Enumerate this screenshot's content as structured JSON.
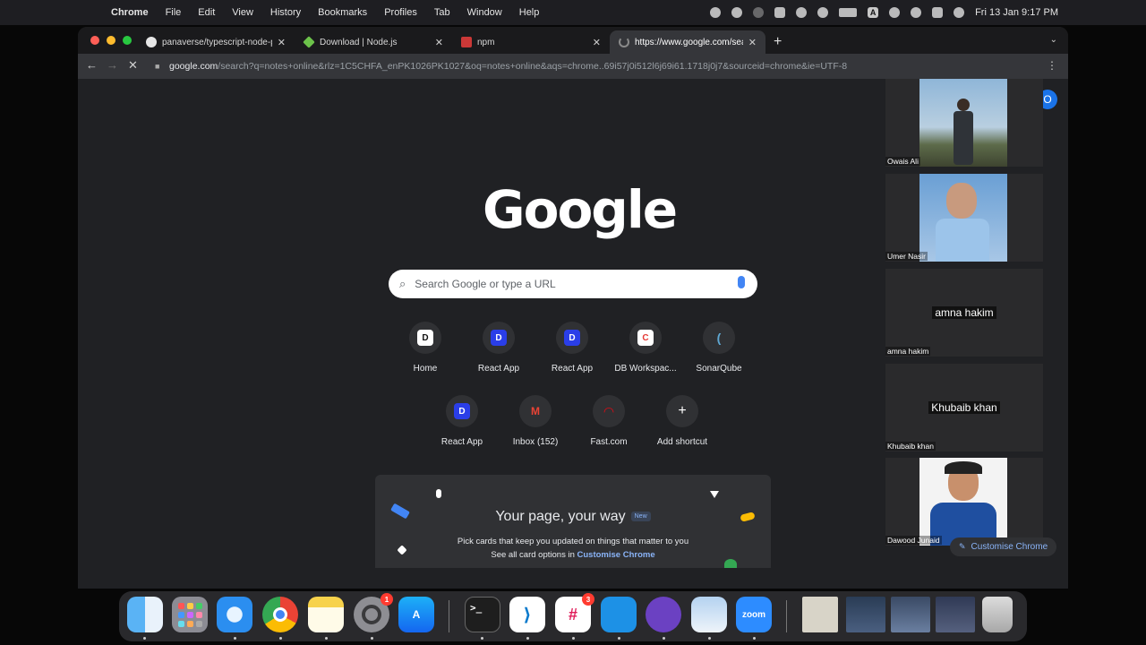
{
  "menubar": {
    "app": "Chrome",
    "items": [
      "File",
      "Edit",
      "View",
      "History",
      "Bookmarks",
      "Profiles",
      "Tab",
      "Window",
      "Help"
    ],
    "status_a": "A",
    "datetime": "Fri 13 Jan  9:17 PM"
  },
  "tabs": [
    {
      "title": "panaverse/typescript-node-pr",
      "favicon": "github-icon"
    },
    {
      "title": "Download | Node.js",
      "favicon": "nodejs-icon"
    },
    {
      "title": "npm",
      "favicon": "npm-icon"
    },
    {
      "title": "https://www.google.com/sear",
      "favicon": "loading-icon"
    }
  ],
  "omnibox": {
    "host": "google.com",
    "path": "/search?q=notes+online&rlz=1C5CHFA_enPK1026PK1027&oq=notes+online&aqs=chrome..69i57j0i512l6j69i61.1718j0j7&sourceid=chrome&ie=UTF-8"
  },
  "google": {
    "logo": "Google",
    "search_placeholder": "Search Google or type a URL"
  },
  "shortcuts": [
    {
      "label": "Home",
      "icon": "D"
    },
    {
      "label": "React App",
      "icon": "D"
    },
    {
      "label": "React App",
      "icon": "D"
    },
    {
      "label": "DB Workspac...",
      "icon": "C"
    },
    {
      "label": "SonarQube",
      "icon": "("
    },
    {
      "label": "React App",
      "icon": "D"
    },
    {
      "label": "Inbox (152)",
      "icon": "M"
    },
    {
      "label": "Fast.com",
      "icon": "◠"
    },
    {
      "label": "Add shortcut",
      "icon": "+"
    }
  ],
  "promo": {
    "title": "Your page, your way",
    "badge": "New",
    "line1": "Pick cards that keep you updated on things that matter to you",
    "line2_prefix": "See all card options in ",
    "line2_link": "Customise Chrome"
  },
  "customise_button": "Customise Chrome",
  "avatar_letter": "O",
  "participants": [
    {
      "name": "Owais Ali",
      "has_photo": true
    },
    {
      "name": "Umer Nasir",
      "has_photo": true
    },
    {
      "name": "amna hakim",
      "has_photo": false
    },
    {
      "name": "Khubaib khan",
      "has_photo": false
    },
    {
      "name": "Dawood Junaid",
      "has_photo": true
    }
  ],
  "dock": {
    "finder": "finder-icon",
    "launchpad": "launchpad-icon",
    "safari": "safari-icon",
    "chrome": "chrome-icon",
    "notes": "notes-icon",
    "settings_badge": "1",
    "appstore": "appstore-icon",
    "terminal": ">_",
    "vscode": "vscode-icon",
    "slack_badge": "3",
    "docker": "docker-icon",
    "github": "github-desktop-icon",
    "preview": "preview-icon",
    "zoom": "zoom"
  }
}
